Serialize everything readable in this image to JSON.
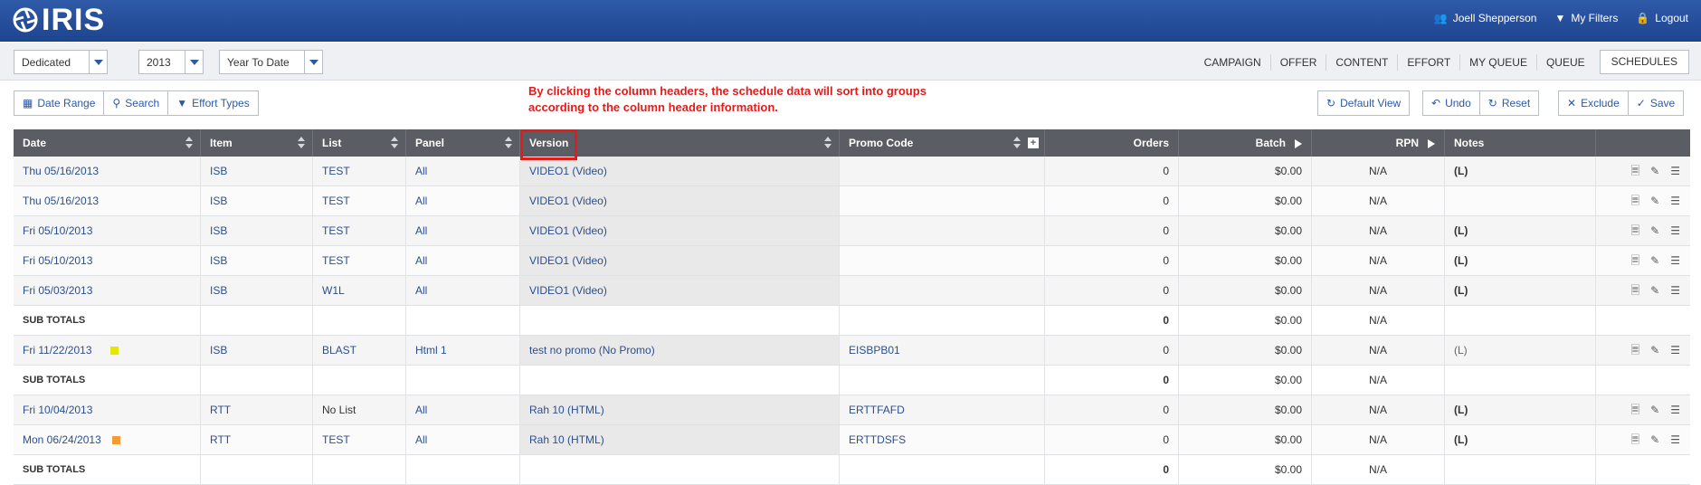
{
  "header": {
    "logo_text": "IRIS",
    "user_name": "Joell Shepperson",
    "my_filters": "My Filters",
    "logout": "Logout"
  },
  "filters": {
    "type": "Dedicated",
    "year": "2013",
    "period": "Year To Date"
  },
  "nav": {
    "tabs": [
      "CAMPAIGN",
      "OFFER",
      "CONTENT",
      "EFFORT",
      "MY QUEUE",
      "QUEUE",
      "SCHEDULES"
    ],
    "active": "SCHEDULES"
  },
  "toolbar": {
    "date_range": "Date Range",
    "search": "Search",
    "effort_types": "Effort Types",
    "default_view": "Default View",
    "undo": "Undo",
    "reset": "Reset",
    "exclude": "Exclude",
    "save": "Save"
  },
  "annotation": "By clicking the column headers, the schedule data will sort into groups according to the column header information.",
  "table": {
    "headers": {
      "date": "Date",
      "item": "Item",
      "list": "List",
      "panel": "Panel",
      "version": "Version",
      "promo": "Promo Code",
      "orders": "Orders",
      "batch": "Batch",
      "rpn": "RPN",
      "notes": "Notes"
    },
    "rows": [
      {
        "date": "Thu 05/16/2013",
        "item": "ISB",
        "list": "TEST",
        "panel": "All",
        "version": "VIDEO1 (Video)",
        "promo": "",
        "orders": "0",
        "batch": "$0.00",
        "rpn": "N/A",
        "notes": "(L)"
      },
      {
        "date": "Thu 05/16/2013",
        "item": "ISB",
        "list": "TEST",
        "panel": "All",
        "version": "VIDEO1 (Video)",
        "promo": "",
        "orders": "0",
        "batch": "$0.00",
        "rpn": "N/A",
        "notes": ""
      },
      {
        "date": "Fri 05/10/2013",
        "item": "ISB",
        "list": "TEST",
        "panel": "All",
        "version": "VIDEO1 (Video)",
        "promo": "",
        "orders": "0",
        "batch": "$0.00",
        "rpn": "N/A",
        "notes": "(L)"
      },
      {
        "date": "Fri 05/10/2013",
        "item": "ISB",
        "list": "TEST",
        "panel": "All",
        "version": "VIDEO1 (Video)",
        "promo": "",
        "orders": "0",
        "batch": "$0.00",
        "rpn": "N/A",
        "notes": "(L)"
      },
      {
        "date": "Fri 05/03/2013",
        "item": "ISB",
        "list": "W1L",
        "panel": "All",
        "version": "VIDEO1 (Video)",
        "promo": "",
        "orders": "0",
        "batch": "$0.00",
        "rpn": "N/A",
        "notes": "(L)"
      }
    ],
    "subtotal_label": "SUB TOTALS",
    "subtotal1": {
      "orders": "0",
      "batch": "$0.00",
      "rpn": "N/A"
    },
    "rows2": [
      {
        "date": "Fri 11/22/2013",
        "item": "ISB",
        "list": "BLAST",
        "panel": "Html 1",
        "version": "test no promo (No Promo)",
        "promo": "EISBPB01",
        "orders": "0",
        "batch": "$0.00",
        "rpn": "N/A",
        "notes": "(L)",
        "mark_color": "#e6e600"
      }
    ],
    "subtotal2": {
      "orders": "0",
      "batch": "$0.00",
      "rpn": "N/A"
    },
    "rows3": [
      {
        "date": "Fri 10/04/2013",
        "item": "RTT",
        "list": "No List",
        "panel": "All",
        "version": "Rah 10 (HTML)",
        "promo": "ERTTFAFD",
        "orders": "0",
        "batch": "$0.00",
        "rpn": "N/A",
        "notes": "(L)"
      },
      {
        "date": "Mon 06/24/2013",
        "item": "RTT",
        "list": "TEST",
        "panel": "All",
        "version": "Rah 10 (HTML)",
        "promo": "ERTTDSFS",
        "orders": "0",
        "batch": "$0.00",
        "rpn": "N/A",
        "notes": "(L)",
        "mark_color": "#f39c33"
      }
    ],
    "subtotal3": {
      "orders": "0",
      "batch": "$0.00",
      "rpn": "N/A"
    }
  },
  "colors": {
    "header_bg": "#2a52a0",
    "annotation": "#e21b1b",
    "link": "#2d4f8c"
  }
}
